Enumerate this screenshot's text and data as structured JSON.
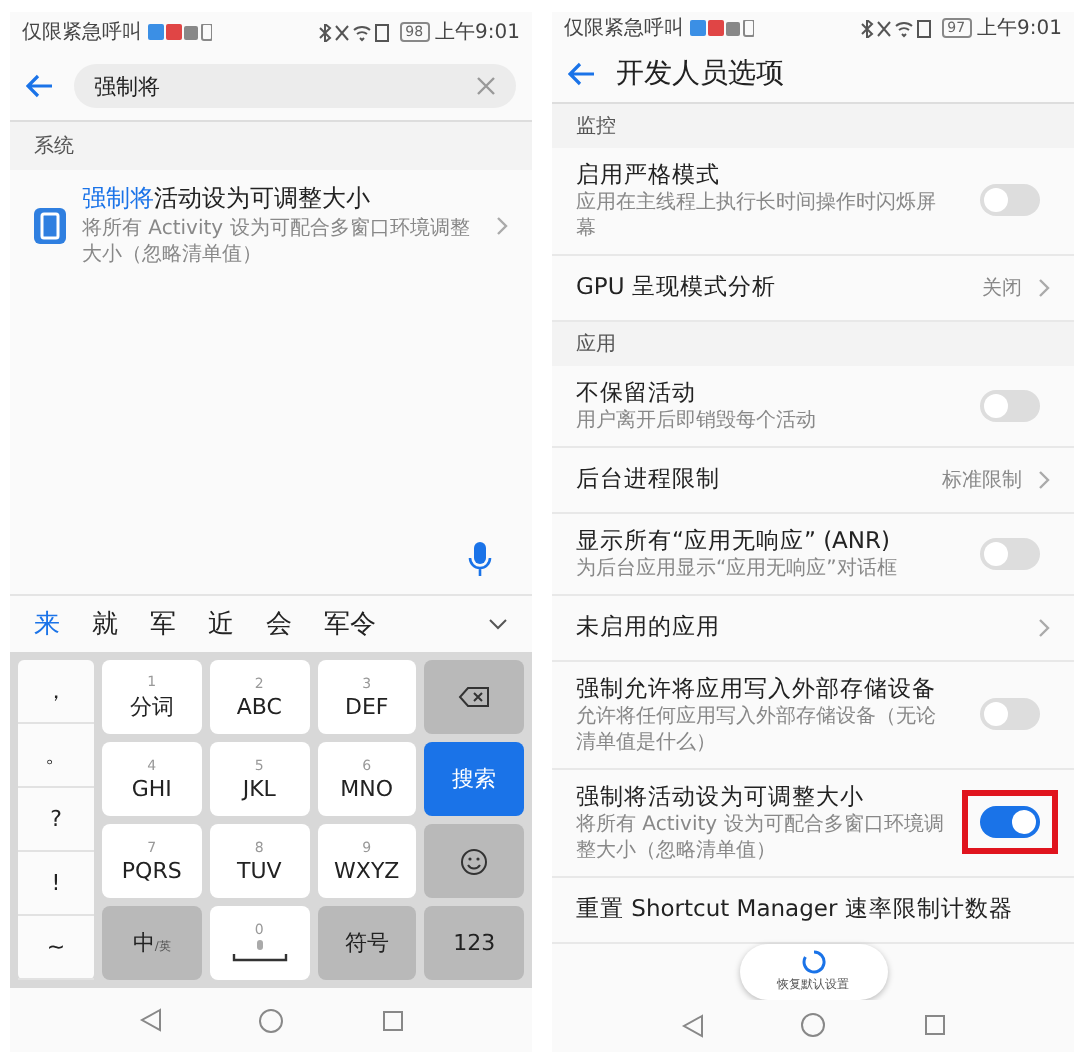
{
  "search_screen": {
    "status_bar": {
      "carrier": "仅限紧急呼叫",
      "battery": "98",
      "time": "上午9:01"
    },
    "search": {
      "value": "强制将"
    },
    "section": "系统",
    "result": {
      "title_match": "强制将",
      "title_rest": "活动设为可调整大小",
      "subtitle": "将所有 Activity 设为可配合多窗口环境调整大小（忽略清单值）"
    },
    "candidates": [
      {
        "label": "来",
        "selected": true
      },
      {
        "label": "就",
        "selected": false
      },
      {
        "label": "军",
        "selected": false
      },
      {
        "label": "近",
        "selected": false
      },
      {
        "label": "会",
        "selected": false
      },
      {
        "label": "军令",
        "selected": false
      }
    ],
    "symbols": [
      "，",
      "。",
      "?",
      "!",
      "~"
    ],
    "keys": [
      {
        "kind": "char",
        "hint": "1",
        "label": "分词"
      },
      {
        "kind": "char",
        "hint": "2",
        "label": "ABC"
      },
      {
        "kind": "char",
        "hint": "3",
        "label": "DEF"
      },
      {
        "kind": "delete"
      },
      {
        "kind": "char",
        "hint": "4",
        "label": "GHI"
      },
      {
        "kind": "char",
        "hint": "5",
        "label": "JKL"
      },
      {
        "kind": "char",
        "hint": "6",
        "label": "MNO"
      },
      {
        "kind": "action",
        "label": "搜索"
      },
      {
        "kind": "char",
        "hint": "7",
        "label": "PQRS"
      },
      {
        "kind": "char",
        "hint": "8",
        "label": "TUV"
      },
      {
        "kind": "char",
        "hint": "9",
        "label": "WXYZ"
      },
      {
        "kind": "emoji"
      },
      {
        "kind": "lang",
        "label": "中",
        "sub": "/英"
      },
      {
        "kind": "space",
        "hint": "0"
      },
      {
        "kind": "function",
        "label": "符号"
      },
      {
        "kind": "function",
        "label": "123"
      }
    ]
  },
  "developer_screen": {
    "status_bar": {
      "carrier": "仅限紧急呼叫",
      "battery": "97",
      "time": "上午9:01"
    },
    "title": "开发人员选项",
    "items": [
      {
        "kind": "section",
        "title": "监控"
      },
      {
        "kind": "toggle",
        "title": "启用严格模式",
        "subtitle": "应用在主线程上执行长时间操作时闪烁屏幕",
        "on": false,
        "highlighted": false
      },
      {
        "kind": "value",
        "title": "GPU 呈现模式分析",
        "value": "关闭"
      },
      {
        "kind": "section",
        "title": "应用"
      },
      {
        "kind": "toggle",
        "title": "不保留活动",
        "subtitle": "用户离开后即销毁每个活动",
        "on": false,
        "highlighted": false
      },
      {
        "kind": "value",
        "title": "后台进程限制",
        "value": "标准限制"
      },
      {
        "kind": "toggle",
        "title": "显示所有“应用无响应” (ANR)",
        "subtitle": "为后台应用显示“应用无响应”对话框",
        "on": false,
        "highlighted": false
      },
      {
        "kind": "link",
        "title": "未启用的应用"
      },
      {
        "kind": "toggle",
        "title": "强制允许将应用写入外部存储设备",
        "subtitle": "允许将任何应用写入外部存储设备（无论清单值是什么）",
        "on": false,
        "highlighted": false
      },
      {
        "kind": "toggle",
        "title": "强制将活动设为可调整大小",
        "subtitle": "将所有 Activity 设为可配合多窗口环境调整大小（忽略清单值）",
        "on": true,
        "highlighted": true
      },
      {
        "kind": "plain",
        "title": "重置 Shortcut Manager 速率限制计数器"
      }
    ],
    "restore_button": "恢复默认设置"
  }
}
